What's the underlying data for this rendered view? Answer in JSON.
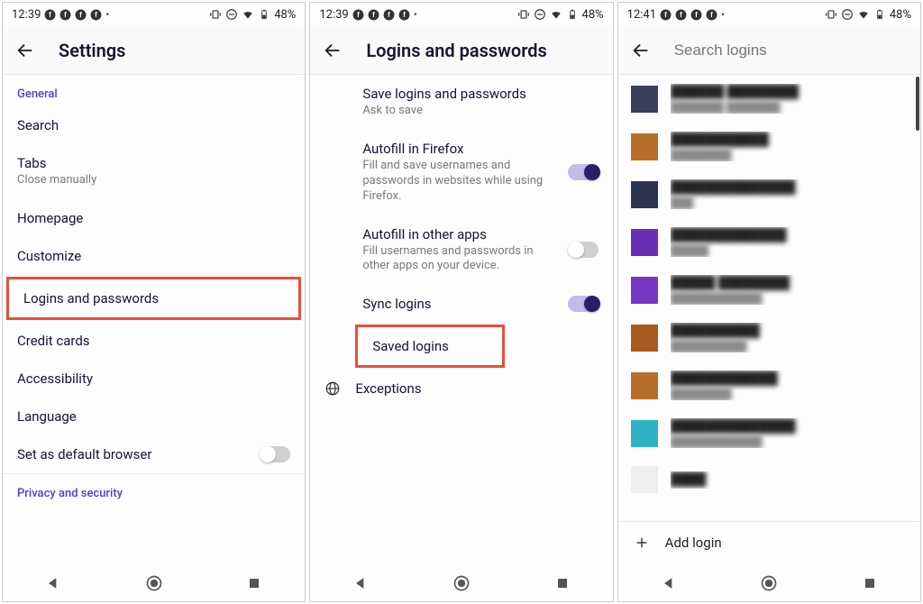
{
  "status": {
    "time1": "12:39",
    "time2": "12:39",
    "time3": "12:41",
    "battery": "48%"
  },
  "screen1": {
    "title": "Settings",
    "section_general": "General",
    "items": {
      "search": "Search",
      "tabs": "Tabs",
      "tabs_sub": "Close manually",
      "homepage": "Homepage",
      "customize": "Customize",
      "logins": "Logins and passwords",
      "credit": "Credit cards",
      "accessibility": "Accessibility",
      "language": "Language",
      "default_browser": "Set as default browser"
    },
    "section_privacy": "Privacy and security"
  },
  "screen2": {
    "title": "Logins and passwords",
    "save_logins": "Save logins and passwords",
    "save_logins_sub": "Ask to save",
    "autofill_ff": "Autofill in Firefox",
    "autofill_ff_sub": "Fill and save usernames and passwords in websites while using Firefox.",
    "autofill_other": "Autofill in other apps",
    "autofill_other_sub": "Fill usernames and passwords in other apps on your device.",
    "sync": "Sync logins",
    "saved": "Saved logins",
    "exceptions": "Exceptions"
  },
  "screen3": {
    "search_placeholder": "Search logins",
    "add_login": "Add login",
    "logins": [
      {
        "color": "#3a3f5c",
        "title": "██████ ████████",
        "sub": "███████ ███████"
      },
      {
        "color": "#b86f2a",
        "title": "███████████",
        "sub": "████████"
      },
      {
        "color": "#2c3252",
        "title": "██████████████",
        "sub": "███"
      },
      {
        "color": "#6b2fb5",
        "title": "█████████████",
        "sub": "█████"
      },
      {
        "color": "#7638c2",
        "title": "█████ ████████",
        "sub": "████████████"
      },
      {
        "color": "#a85a1f",
        "title": "██████████",
        "sub": "██████████"
      },
      {
        "color": "#b86f2a",
        "title": "████████████",
        "sub": "████████"
      },
      {
        "color": "#2db3c4",
        "title": "██████████████",
        "sub": "████████████"
      },
      {
        "color": "#eeeeee",
        "title": "████",
        "sub": ""
      }
    ]
  }
}
